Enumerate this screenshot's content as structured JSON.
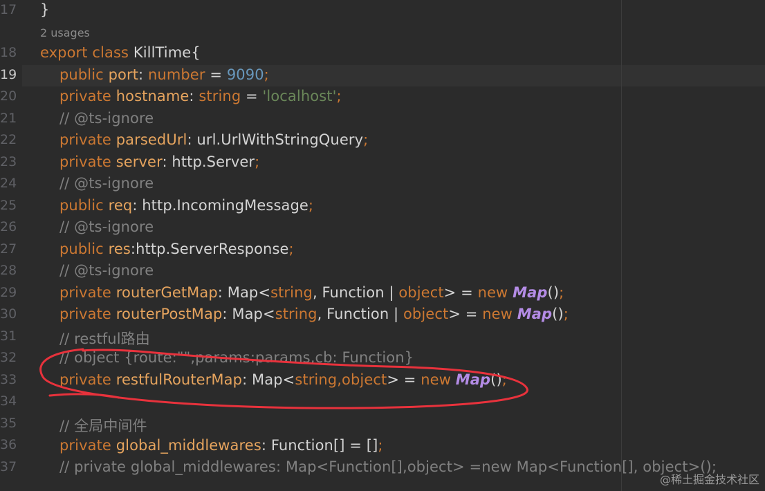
{
  "editor": {
    "usages_hint": "2 usages",
    "line_numbers": [
      "17",
      "18",
      "19",
      "20",
      "21",
      "22",
      "23",
      "24",
      "25",
      "26",
      "27",
      "28",
      "29",
      "30",
      "31",
      "32",
      "33",
      "34",
      "35",
      "36",
      "37"
    ],
    "active_line": "19",
    "code": {
      "l17": "}",
      "l18_kw1": "export",
      "l18_kw2": "class",
      "l18_name": "KillTime{",
      "l19_kw": "public",
      "l19_field": "port",
      "l19_colon": ":",
      "l19_type": "number",
      "l19_eq": " = ",
      "l19_num": "9090",
      "l19_semi": ";",
      "l20_kw": "private",
      "l20_field": "hostname",
      "l20_colon": ":",
      "l20_type": "string",
      "l20_eq": " = ",
      "l20_str": "'localhost'",
      "l20_semi": ";",
      "l21": "// @ts-ignore",
      "l22_kw": "private",
      "l22_field": "parsedUrl",
      "l22_rest": ": url.UrlWithStringQuery",
      "l22_semi": ";",
      "l23_kw": "private",
      "l23_field": "server",
      "l23_rest": ": http.Server",
      "l23_semi": ";",
      "l24": "// @ts-ignore",
      "l25_kw": "public",
      "l25_field": "req",
      "l25_rest": ": http.IncomingMessage",
      "l25_semi": ";",
      "l26": "// @ts-ignore",
      "l27_kw": "public",
      "l27_field": "res",
      "l27_rest": ":http.ServerResponse",
      "l27_semi": ";",
      "l28": "// @ts-ignore",
      "l29_kw": "private",
      "l29_field": "routerGetMap",
      "l29_a": ": Map<",
      "l29_t1": "string",
      "l29_b": ", Function | ",
      "l29_t2": "object",
      "l29_c": "> = ",
      "l29_new": "new",
      "l29_fn": "Map",
      "l29_d": "()",
      "l29_semi": ";",
      "l30_kw": "private",
      "l30_field": "routerPostMap",
      "l30_a": ": Map<",
      "l30_t1": "string",
      "l30_b": ", Function | ",
      "l30_t2": "object",
      "l30_c": "> = ",
      "l30_new": "new",
      "l30_fn": "Map",
      "l30_d": "()",
      "l30_semi": ";",
      "l31": "// restful路由",
      "l32": "// object {route:\"\",params:params,cb: Function}",
      "l33_kw": "private",
      "l33_field": "restfulRouterMap",
      "l33_a": ": Map<",
      "l33_t1": "string",
      "l33_b": ",",
      "l33_t2": "object",
      "l33_c": "> = ",
      "l33_new": "new",
      "l33_fn": "Map",
      "l33_d": "()",
      "l33_semi": ";",
      "l35": "// 全局中间件",
      "l36_kw": "private",
      "l36_field": "global_middlewares",
      "l36_rest": ": Function[] = []",
      "l36_semi": ";",
      "l37": "// private global_middlewares: Map<Function[],object> =new Map<Function[], object>();"
    },
    "watermark": "@稀土掘金技术社区"
  },
  "colors": {
    "background": "#2b2b2b",
    "keyword": "#cc7832",
    "field": "#e6a45e",
    "number": "#6897bb",
    "string": "#6a8759",
    "comment": "#808080",
    "function": "#b48ce6",
    "annotation": "#e8323c"
  }
}
